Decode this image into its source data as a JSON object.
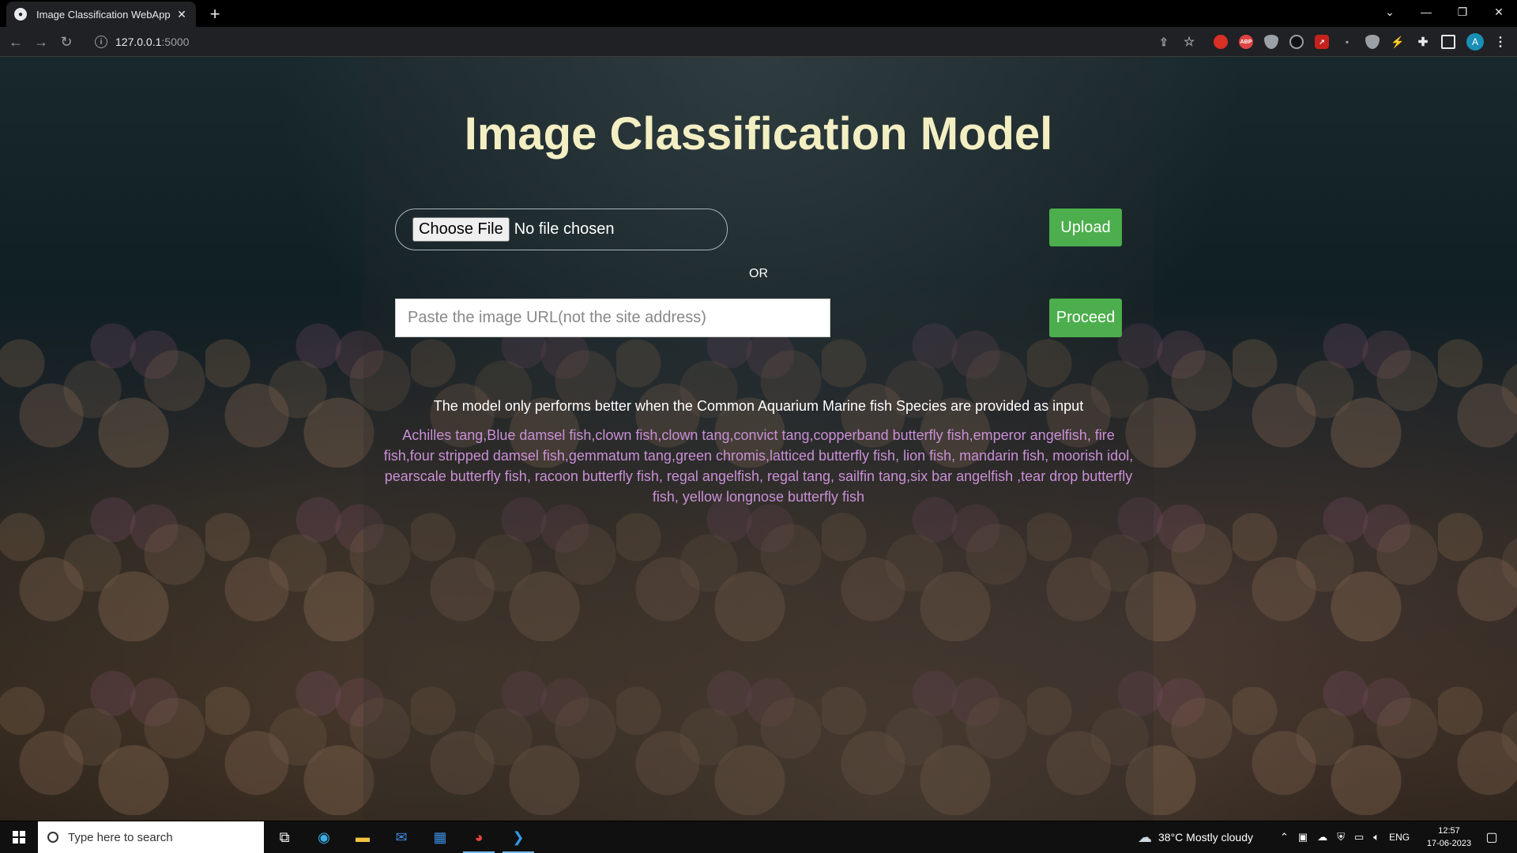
{
  "browser": {
    "tab_title": "Image Classification WebApp",
    "new_tab": "+",
    "url_host": "127.0.0.1",
    "url_port": ":5000"
  },
  "page": {
    "title": "Image Classification Model",
    "choose_file_label": "Choose File",
    "no_file_text": "No file chosen",
    "upload_label": "Upload",
    "or_text": "OR",
    "url_placeholder": "Paste the image URL(not the site address)",
    "proceed_label": "Proceed",
    "note": "The model only performs better when the Common Aquarium Marine fish Species are provided as input",
    "species": "Achilles tang,Blue damsel fish,clown fish,clown tang,convict tang,copperband butterfly fish,emperor angelfish, fire fish,four stripped damsel fish,gemmatum tang,green chromis,latticed butterfly fish, lion fish, mandarin fish, moorish idol, pearscale butterfly fish, racoon butterfly fish, regal angelfish, regal tang, sailfin tang,six bar angelfish ,tear drop butterfly fish, yellow longnose butterfly fish"
  },
  "taskbar": {
    "search_placeholder": "Type here to search",
    "weather": "38°C  Mostly cloudy",
    "language": "ENG",
    "time": "12:57",
    "date": "17-06-2023"
  },
  "colors": {
    "title": "#f3efc3",
    "button_green": "#4cae4c",
    "species_text": "#c98fd6"
  }
}
